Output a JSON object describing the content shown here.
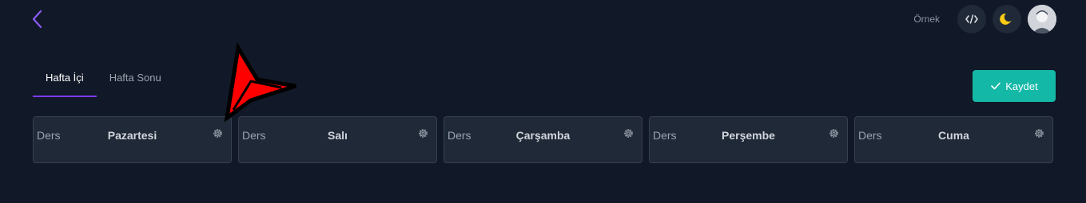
{
  "header": {
    "back_icon": "chevron-left-icon",
    "example_label": "Örnek",
    "code_icon": "code-icon",
    "theme_icon": "moon-icon",
    "avatar_icon": "user-avatar"
  },
  "tabs": [
    {
      "label": "Hafta İçi",
      "active": true
    },
    {
      "label": "Hafta Sonu",
      "active": false
    }
  ],
  "save_button": {
    "label": "Kaydet",
    "icon": "check-icon"
  },
  "days": [
    {
      "prefix": "Ders",
      "name": "Pazartesi",
      "icon": "gear-icon"
    },
    {
      "prefix": "Ders",
      "name": "Salı",
      "icon": "gear-icon"
    },
    {
      "prefix": "Ders",
      "name": "Çarşamba",
      "icon": "gear-icon"
    },
    {
      "prefix": "Ders",
      "name": "Perşembe",
      "icon": "gear-icon"
    },
    {
      "prefix": "Ders",
      "name": "Cuma",
      "icon": "gear-icon"
    }
  ],
  "colors": {
    "background": "#111827",
    "card": "#1f2937",
    "accent_purple": "#7c3aed",
    "save_teal": "#14b8a6",
    "moon_yellow": "#facc15",
    "pointer_red": "#ff0000"
  }
}
